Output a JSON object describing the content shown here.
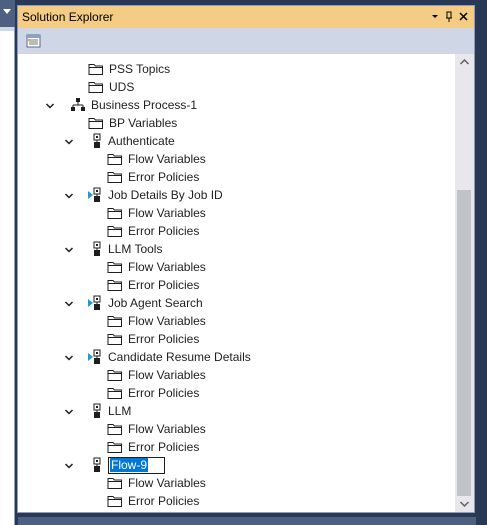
{
  "window": {
    "title": "Solution Explorer",
    "buttons": {
      "dropdown": "▾",
      "pin": "⊣",
      "close": "✕"
    }
  },
  "toolbar": {
    "properties_icon": "properties-icon"
  },
  "tree": [
    {
      "type": "folder",
      "label": "PSS Topics",
      "level": 3,
      "expander": "none"
    },
    {
      "type": "folder",
      "label": "UDS",
      "level": 3,
      "expander": "none"
    },
    {
      "type": "process",
      "label": "Business Process-1",
      "level": 2,
      "expander": "expanded"
    },
    {
      "type": "folder",
      "label": "BP Variables",
      "level": 3,
      "expander": "none"
    },
    {
      "type": "flow",
      "label": "Authenticate",
      "level": 3,
      "expander": "expanded",
      "start": false
    },
    {
      "type": "folder",
      "label": "Flow Variables",
      "level": 4,
      "expander": "none"
    },
    {
      "type": "folder",
      "label": "Error Policies",
      "level": 4,
      "expander": "none"
    },
    {
      "type": "flow",
      "label": "Job Details By Job ID",
      "level": 3,
      "expander": "expanded",
      "start": true
    },
    {
      "type": "folder",
      "label": "Flow Variables",
      "level": 4,
      "expander": "none"
    },
    {
      "type": "folder",
      "label": "Error Policies",
      "level": 4,
      "expander": "none"
    },
    {
      "type": "flow",
      "label": "LLM Tools",
      "level": 3,
      "expander": "expanded",
      "start": false
    },
    {
      "type": "folder",
      "label": "Flow Variables",
      "level": 4,
      "expander": "none"
    },
    {
      "type": "folder",
      "label": "Error Policies",
      "level": 4,
      "expander": "none"
    },
    {
      "type": "flow",
      "label": "Job Agent Search",
      "level": 3,
      "expander": "expanded",
      "start": true
    },
    {
      "type": "folder",
      "label": "Flow Variables",
      "level": 4,
      "expander": "none"
    },
    {
      "type": "folder",
      "label": "Error Policies",
      "level": 4,
      "expander": "none"
    },
    {
      "type": "flow",
      "label": "Candidate Resume Details",
      "level": 3,
      "expander": "expanded",
      "start": true
    },
    {
      "type": "folder",
      "label": "Flow Variables",
      "level": 4,
      "expander": "none"
    },
    {
      "type": "folder",
      "label": "Error Policies",
      "level": 4,
      "expander": "none"
    },
    {
      "type": "flow",
      "label": "LLM",
      "level": 3,
      "expander": "expanded",
      "start": false
    },
    {
      "type": "folder",
      "label": "Flow Variables",
      "level": 4,
      "expander": "none"
    },
    {
      "type": "folder",
      "label": "Error Policies",
      "level": 4,
      "expander": "none"
    },
    {
      "type": "flow",
      "label": "Flow-9",
      "level": 3,
      "expander": "expanded",
      "start": false,
      "editing": true
    },
    {
      "type": "folder",
      "label": "Flow Variables",
      "level": 4,
      "expander": "none"
    },
    {
      "type": "folder",
      "label": "Error Policies",
      "level": 4,
      "expander": "none"
    }
  ],
  "colors": {
    "title_bar": "#f5cc84",
    "toolbar": "#cfd6e5",
    "frame": "#293955",
    "selection": "#0078d7",
    "start_arrow": "#1e9bd7"
  }
}
